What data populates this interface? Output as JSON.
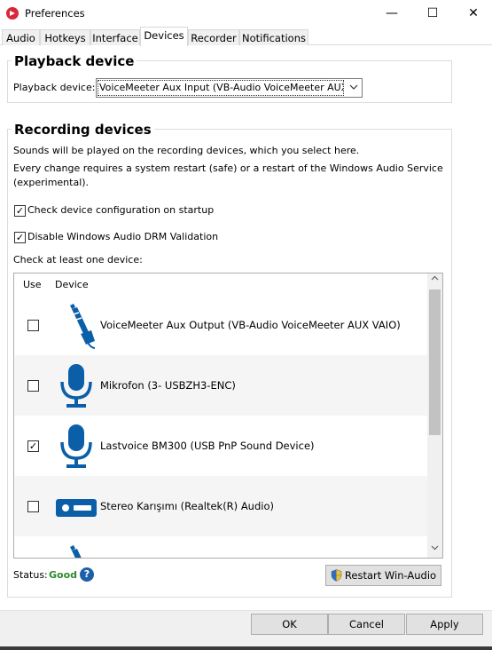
{
  "window": {
    "title": "Preferences",
    "min_glyph": "—",
    "max_glyph": "☐",
    "close_glyph": "✕"
  },
  "tabs": [
    {
      "label": "Audio"
    },
    {
      "label": "Hotkeys"
    },
    {
      "label": "Interface"
    },
    {
      "label": "Devices"
    },
    {
      "label": "Recorder"
    },
    {
      "label": "Notifications"
    }
  ],
  "active_tab": "Devices",
  "playback": {
    "group_title": "Playback device",
    "label": "Playback device:",
    "selected": "VoiceMeeter Aux Input (VB-Audio VoiceMeeter AUX"
  },
  "recording": {
    "group_title": "Recording devices",
    "info1": "Sounds will be played on the recording devices, which you select here.",
    "info2": "Every change requires a system restart (safe) or a restart of the Windows Audio Service",
    "info3": "(experimental).",
    "check_config": {
      "label": "Check device configuration on startup",
      "checked": true
    },
    "disable_drm": {
      "label": "Disable Windows Audio DRM Validation",
      "checked": true
    },
    "check_one": "Check at least one device:",
    "columns": {
      "use": "Use",
      "device": "Device"
    },
    "devices": [
      {
        "name": "VoiceMeeter Aux Output (VB-Audio VoiceMeeter AUX VAIO)",
        "checked": false,
        "icon": "audio-jack-icon"
      },
      {
        "name": "Mikrofon (3- USBZH3-ENC)",
        "checked": false,
        "icon": "microphone-icon"
      },
      {
        "name": "Lastvoice BM300 (USB PnP Sound Device)",
        "checked": true,
        "icon": "microphone-icon"
      },
      {
        "name": "Stereo Karışımı (Realtek(R) Audio)",
        "checked": false,
        "icon": "stereo-mix-icon"
      }
    ],
    "status_label": "Status:",
    "status_value": "Good",
    "help_glyph": "?",
    "restart_button": "Restart Win-Audio"
  },
  "buttons": {
    "ok": "OK",
    "cancel": "Cancel",
    "apply": "Apply"
  },
  "colors": {
    "accent": "#1f5fa8",
    "status_good": "#2e8b2e",
    "icon_blue": "#0b5fa8"
  }
}
